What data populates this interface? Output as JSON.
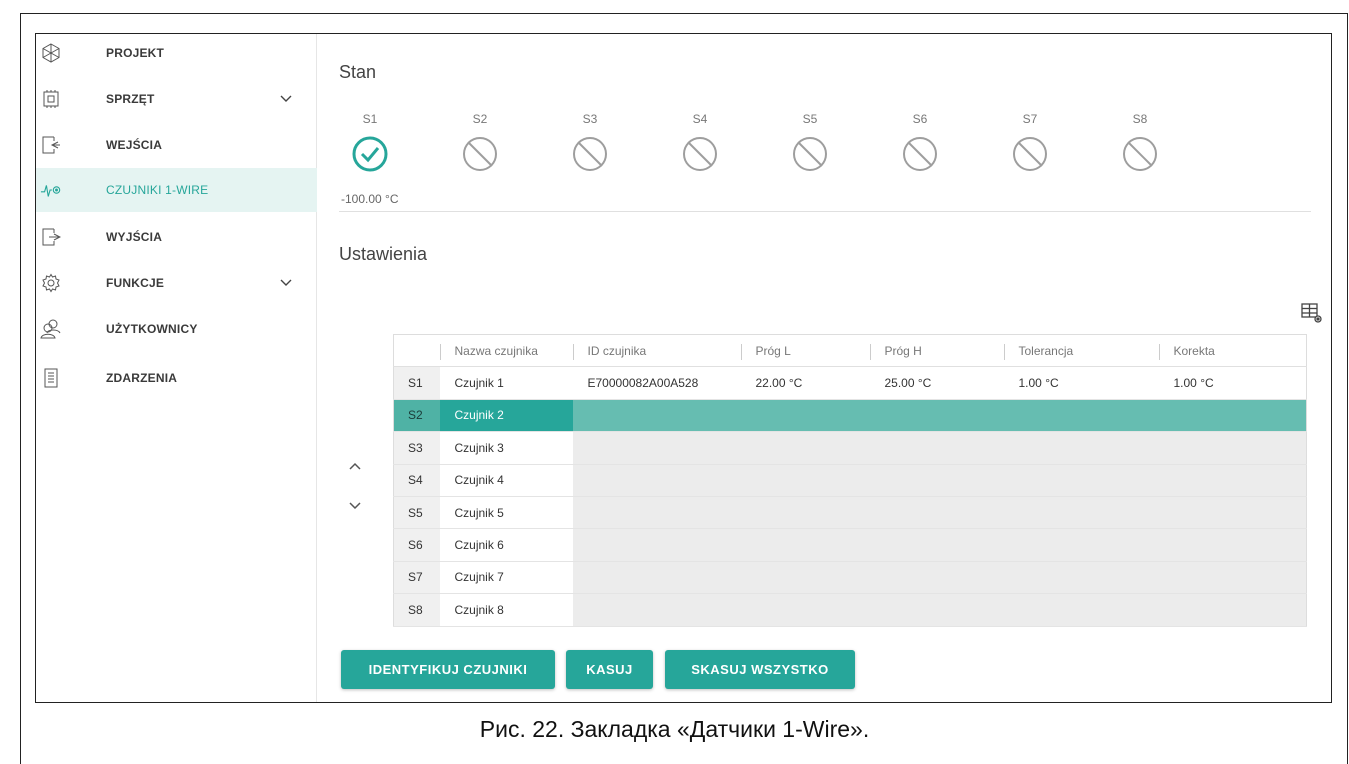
{
  "sidebar": {
    "items": [
      {
        "label": "PROJEKT",
        "icon": "project-icon",
        "chevron": false,
        "active": false
      },
      {
        "label": "SPRZĘT",
        "icon": "hardware-icon",
        "chevron": true,
        "active": false
      },
      {
        "label": "WEJŚCIA",
        "icon": "inputs-icon",
        "chevron": false,
        "active": false
      },
      {
        "label": "CZUJNIKI 1-WIRE",
        "icon": "pulse-sensor-icon",
        "chevron": false,
        "active": true
      },
      {
        "label": "WYJŚCIA",
        "icon": "outputs-icon",
        "chevron": false,
        "active": false
      },
      {
        "label": "FUNKCJE",
        "icon": "gear-icon",
        "chevron": true,
        "active": false
      },
      {
        "label": "UŻYTKOWNICY",
        "icon": "users-icon",
        "chevron": false,
        "active": false
      },
      {
        "label": "ZDARZENIA",
        "icon": "events-list-icon",
        "chevron": false,
        "active": false
      }
    ]
  },
  "status": {
    "title": "Stan",
    "sensors": [
      {
        "label": "S1",
        "state": "ok",
        "icon": "check-circle-icon"
      },
      {
        "label": "S2",
        "state": "off",
        "icon": "disabled-circle-icon"
      },
      {
        "label": "S3",
        "state": "off",
        "icon": "disabled-circle-icon"
      },
      {
        "label": "S4",
        "state": "off",
        "icon": "disabled-circle-icon"
      },
      {
        "label": "S5",
        "state": "off",
        "icon": "disabled-circle-icon"
      },
      {
        "label": "S6",
        "state": "off",
        "icon": "disabled-circle-icon"
      },
      {
        "label": "S7",
        "state": "off",
        "icon": "disabled-circle-icon"
      },
      {
        "label": "S8",
        "state": "off",
        "icon": "disabled-circle-icon"
      }
    ],
    "temperature": "-100.00 °C"
  },
  "settings": {
    "title": "Ustawienia",
    "columns": [
      "",
      "Nazwa czujnika",
      "ID czujnika",
      "Próg L",
      "Próg H",
      "Tolerancja",
      "Korekta"
    ],
    "rows": [
      {
        "idx": "S1",
        "name": "Czujnik 1",
        "id": "E70000082A00A528",
        "low": "22.00 °C",
        "high": "25.00 °C",
        "tolerance": "1.00 °C",
        "correction": "1.00 °C"
      },
      {
        "idx": "S2",
        "name": "Czujnik 2",
        "id": "",
        "low": "",
        "high": "",
        "tolerance": "",
        "correction": ""
      },
      {
        "idx": "S3",
        "name": "Czujnik 3",
        "id": "",
        "low": "",
        "high": "",
        "tolerance": "",
        "correction": ""
      },
      {
        "idx": "S4",
        "name": "Czujnik 4",
        "id": "",
        "low": "",
        "high": "",
        "tolerance": "",
        "correction": ""
      },
      {
        "idx": "S5",
        "name": "Czujnik 5",
        "id": "",
        "low": "",
        "high": "",
        "tolerance": "",
        "correction": ""
      },
      {
        "idx": "S6",
        "name": "Czujnik 6",
        "id": "",
        "low": "",
        "high": "",
        "tolerance": "",
        "correction": ""
      },
      {
        "idx": "S7",
        "name": "Czujnik 7",
        "id": "",
        "low": "",
        "high": "",
        "tolerance": "",
        "correction": ""
      },
      {
        "idx": "S8",
        "name": "Czujnik 8",
        "id": "",
        "low": "",
        "high": "",
        "tolerance": "",
        "correction": ""
      }
    ],
    "selected_row": "S2"
  },
  "buttons": {
    "identify": "IDENTYFIKUJ CZUJNIKI",
    "delete": "KASUJ",
    "delete_all": "SKASUJ WSZYSTKO"
  },
  "caption": "Рис. 22. Закладка «Датчики 1-Wire».",
  "colors": {
    "accent": "#26a69a",
    "selected_row": "#66bdb1",
    "active_nav_bg": "#e5f4f2"
  }
}
